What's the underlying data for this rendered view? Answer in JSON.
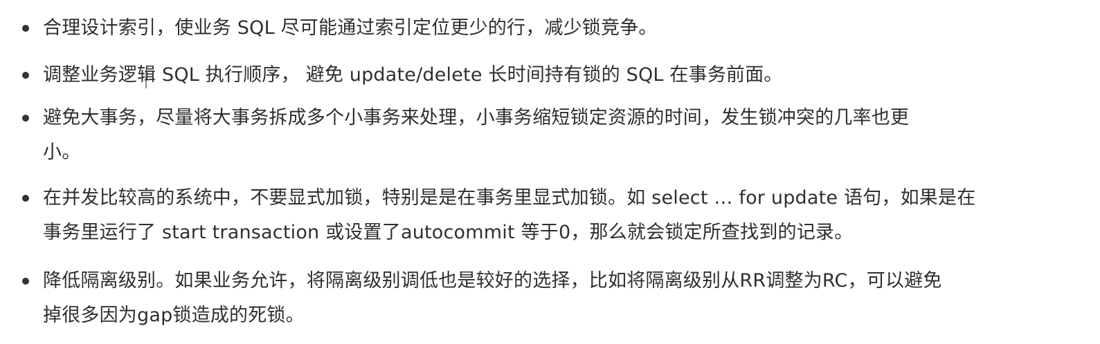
{
  "document": {
    "items": [
      {
        "lines": [
          "合理设计索引，使业务 SQL 尽可能通过索引定位更少的行，减少锁竞争。"
        ]
      },
      {
        "lines": [
          "调整业务逻辑 SQL 执行顺序， 避免 update/delete 长时间持有锁的 SQL 在事务前面。"
        ]
      },
      {
        "lines": [
          "避免大事务，尽量将大事务拆成多个小事务来处理，小事务缩短锁定资源的时间，发生锁冲突的几率也更",
          "小。"
        ]
      },
      {
        "lines": [
          "在并发比较高的系统中，不要显式加锁，特别是是在事务里显式加锁。如 select … for update 语句，如果是在",
          "事务里运行了 start transaction 或设置了autocommit 等于0，那么就会锁定所查找到的记录。"
        ]
      },
      {
        "lines": [
          "降低隔离级别。如果业务允许，将隔离级别调低也是较好的选择，比如将隔离级别从RR调整为RC，可以避免",
          "掉很多因为gap锁造成的死锁。"
        ]
      }
    ]
  }
}
